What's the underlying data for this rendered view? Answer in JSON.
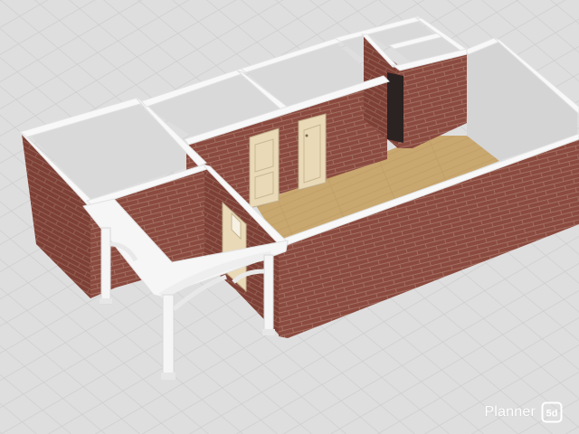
{
  "watermark": {
    "brand": "Planner",
    "logo_text": "5d"
  },
  "scene": {
    "floor_color": "#dedede",
    "grid_color": "#cdcdcd",
    "brick_color": "#8b4a3f",
    "mortar_color": "#b58f80",
    "wall_top_color": "#f7f7f7",
    "interior_color": "#d6d6d6",
    "wood_floor_color": "#c9a870",
    "door_color": "#ead9b7"
  }
}
